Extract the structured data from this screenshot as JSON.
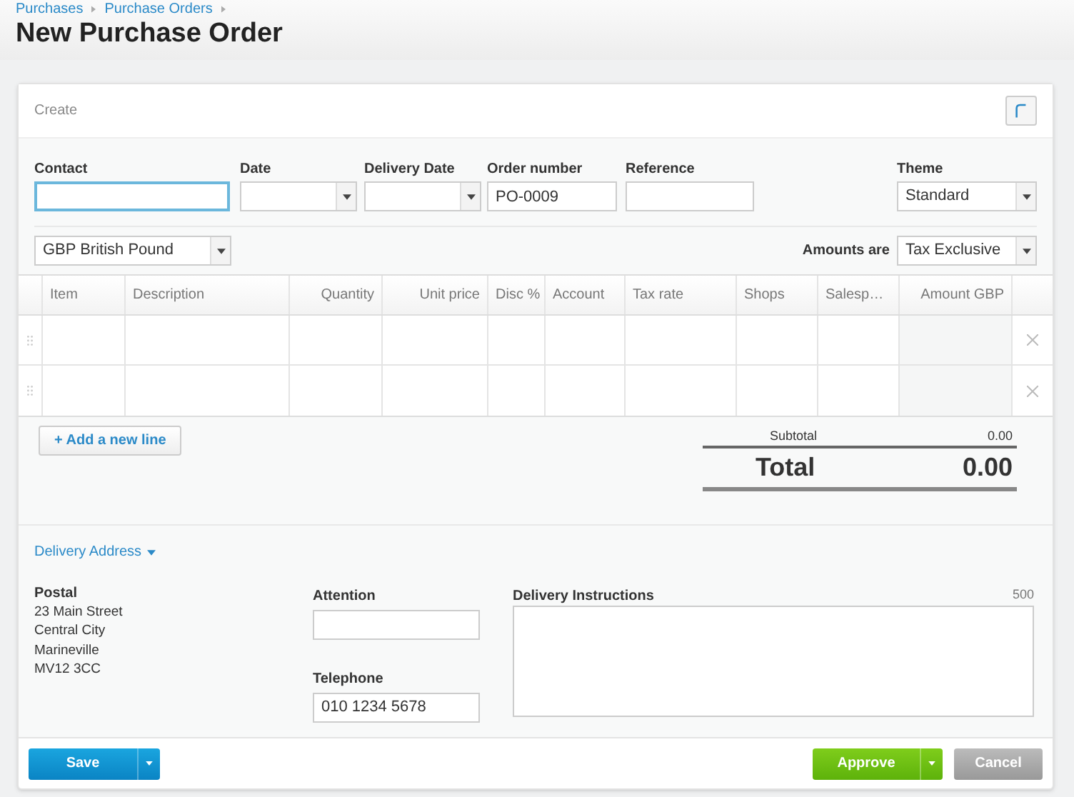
{
  "breadcrumbs": [
    "Purchases",
    "Purchase Orders"
  ],
  "title": "New Purchase Order",
  "card_title": "Create",
  "fields": [
    {
      "label": "Contact",
      "kind": "text",
      "focused": true
    },
    {
      "label": "Date",
      "kind": "select",
      "focused": false
    },
    {
      "label": "Delivery Date",
      "kind": "select",
      "focused": false
    },
    {
      "label": "Order number",
      "kind": "text",
      "value": "PO-0009",
      "focused": false
    },
    {
      "label": "Reference",
      "kind": "text",
      "focused": false
    }
  ],
  "theme": {
    "label": "Theme",
    "value": "Standard"
  },
  "currency": {
    "value": "GBP British Pound"
  },
  "amounts": {
    "label": "Amounts are",
    "value": "Tax Exclusive"
  },
  "table": {
    "columns": [
      {
        "label": "Item",
        "kind": "text"
      },
      {
        "label": "Description",
        "kind": "text"
      },
      {
        "label": "Quantity",
        "kind": "numeric"
      },
      {
        "label": "Unit price",
        "kind": "numeric"
      },
      {
        "label": "Disc %",
        "kind": "text"
      },
      {
        "label": "Account",
        "kind": "text"
      },
      {
        "label": "Tax rate",
        "kind": "text"
      },
      {
        "label": "Shops",
        "kind": "text"
      },
      {
        "label": "Salesp…",
        "kind": "text"
      },
      {
        "label": "Amount GBP",
        "kind": "readonly"
      }
    ],
    "rows": [
      {
        "removable": true
      },
      {
        "removable": true
      }
    ]
  },
  "add_line": "+ Add a new line",
  "totals": {
    "subtotal_label": "Subtotal",
    "subtotal": "0.00",
    "total_label": "Total",
    "total": "0.00"
  },
  "delivery": {
    "toggle": "Delivery Address",
    "expanded": true,
    "postal_label": "Postal",
    "postal_lines": [
      "23 Main Street",
      "Central City",
      "Marineville",
      "MV12 3CC"
    ],
    "attention_label": "Attention",
    "telephone_label": "Telephone",
    "telephone": "010 1234 5678",
    "instructions_label": "Delivery Instructions",
    "char_limit": "500"
  },
  "buttons": {
    "save": "Save",
    "approve": "Approve",
    "cancel": "Cancel"
  }
}
